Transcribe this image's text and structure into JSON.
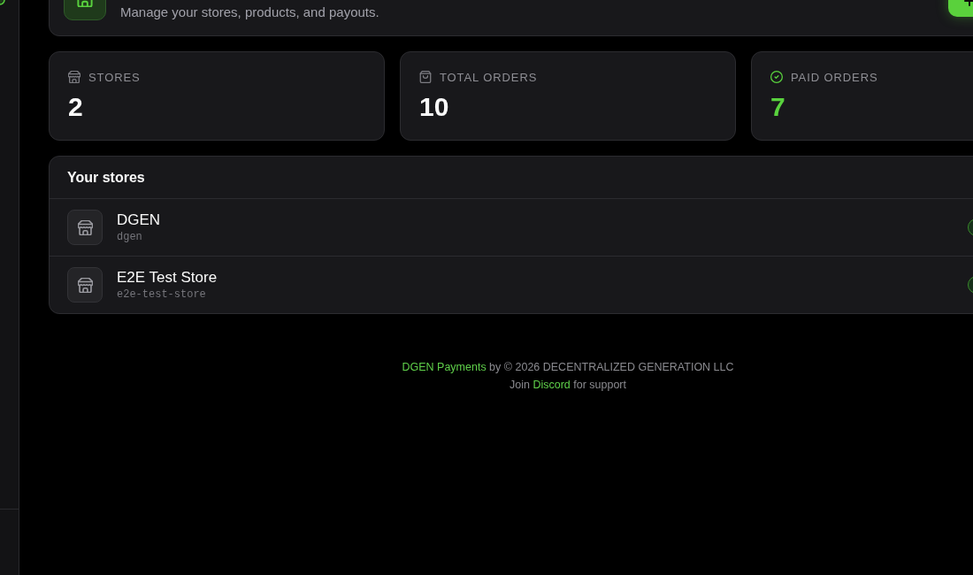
{
  "header": {
    "subtitle": "Manage your stores, products, and payouts."
  },
  "stats": [
    {
      "kind": "stores",
      "label": "STORES",
      "value": "2"
    },
    {
      "kind": "orders",
      "label": "TOTAL ORDERS",
      "value": "10"
    },
    {
      "kind": "paid",
      "label": "PAID ORDERS",
      "value": "7"
    }
  ],
  "stores_panel": {
    "title": "Your stores",
    "stores": [
      {
        "name": "DGEN",
        "slug": "dgen"
      },
      {
        "name": "E2E Test Store",
        "slug": "e2e-test-store"
      }
    ]
  },
  "footer": [
    {
      "link": "DGEN Payments",
      "after": "by © 2026 DECENTRALIZED GENERATION LLC"
    },
    {
      "before": "Join",
      "link": "Discord",
      "after": "for support"
    }
  ]
}
